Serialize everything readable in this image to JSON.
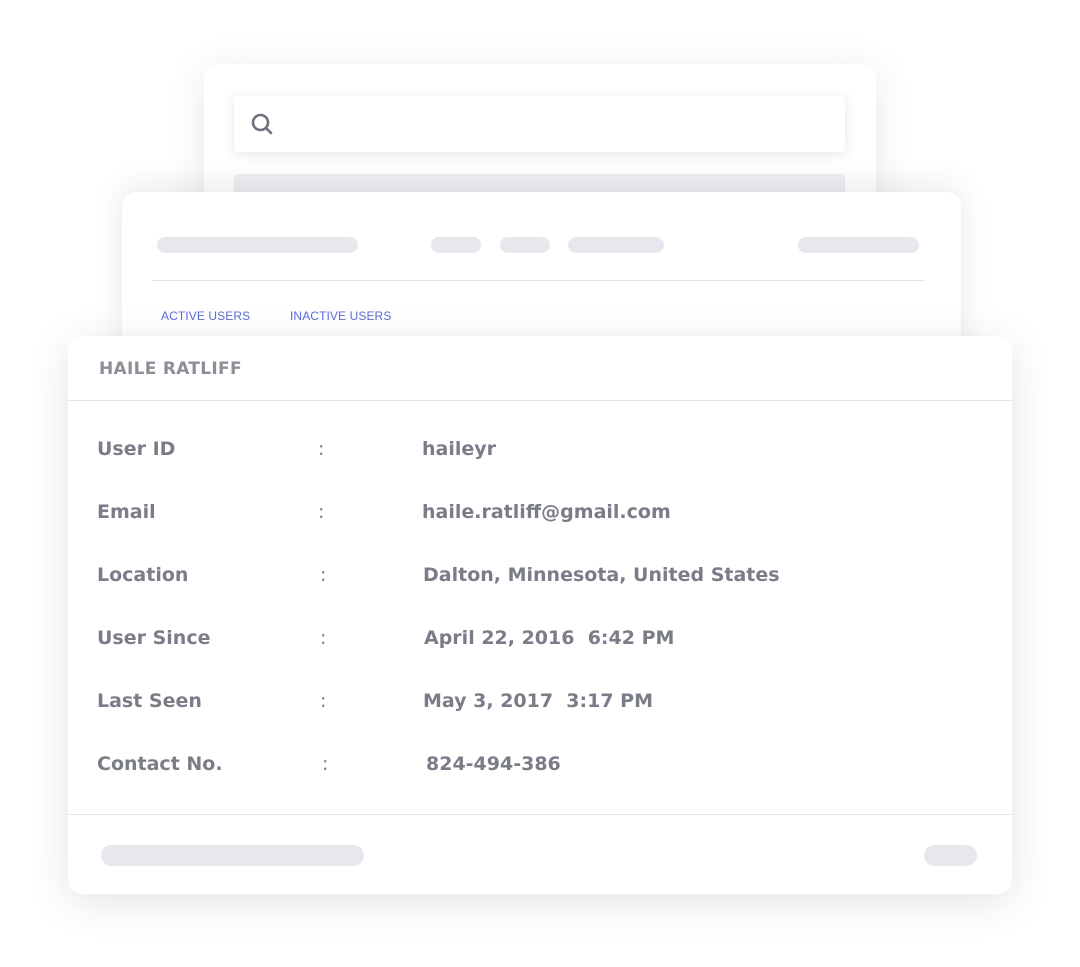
{
  "search": {
    "value": "",
    "icon": "search-icon"
  },
  "users_panel": {
    "tabs": [
      {
        "label": "ACTIVE USERS"
      },
      {
        "label": "INACTIVE USERS"
      }
    ],
    "accent_color": "#5b6cd6"
  },
  "user_card": {
    "title": "HAILE RATLIFF",
    "separator": ":",
    "details": [
      {
        "label": "User ID",
        "value": "haileyr"
      },
      {
        "label": "Email",
        "value": "haile.ratliff@gmail.com"
      },
      {
        "label": "Location",
        "value": "Dalton, Minnesota, United States"
      },
      {
        "label": "User Since",
        "value": "April 22, 2016  6:42 PM"
      },
      {
        "label": "Last Seen",
        "value": "May 3, 2017  3:17 PM"
      },
      {
        "label": "Contact No.",
        "value": "824-494-386"
      }
    ]
  }
}
